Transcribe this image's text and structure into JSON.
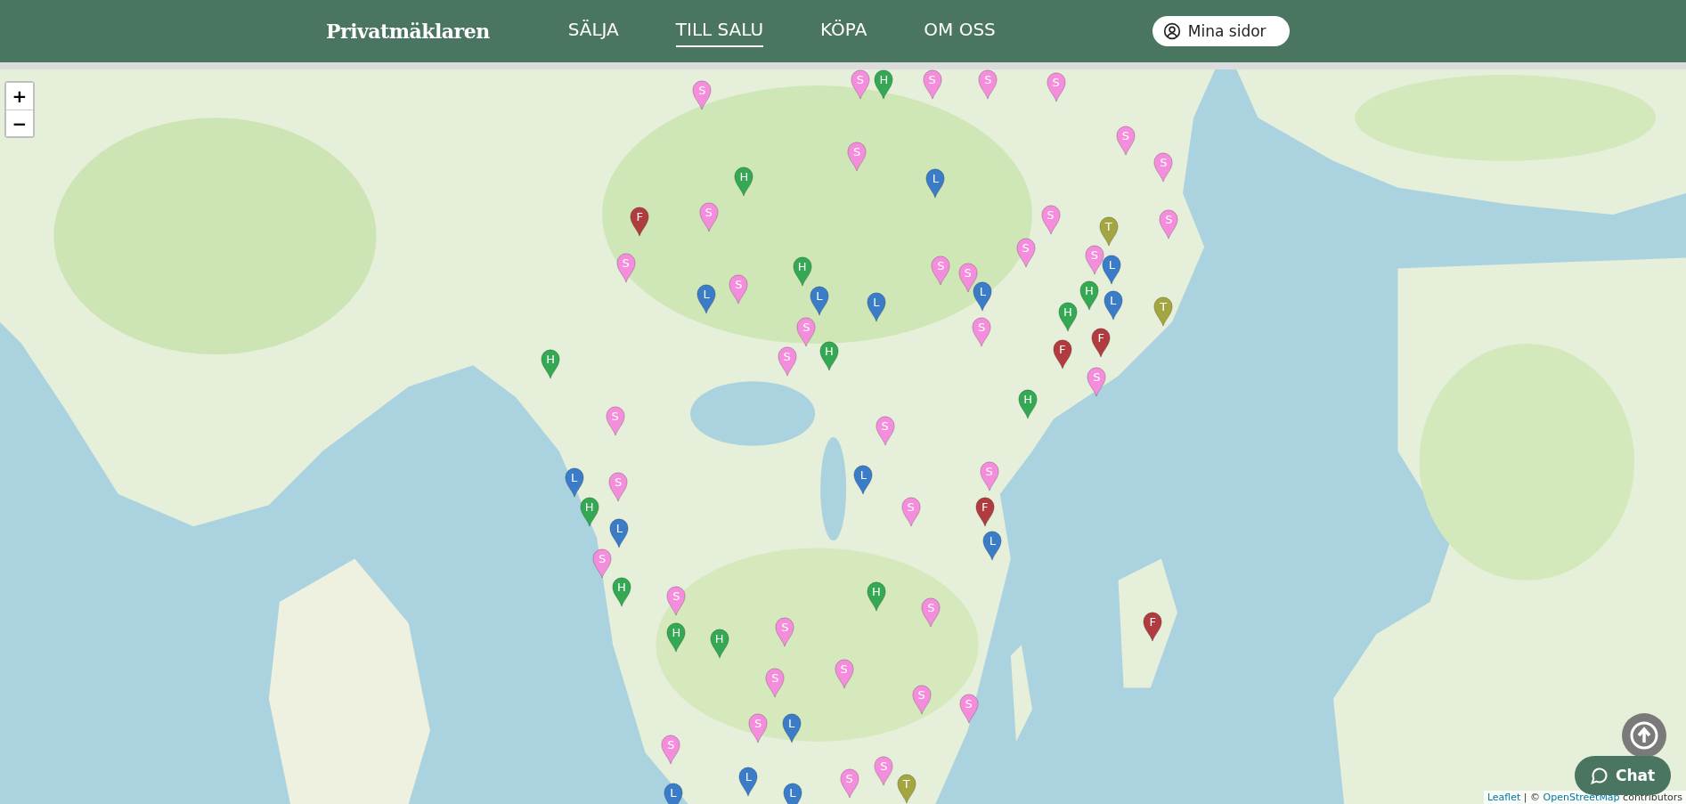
{
  "header": {
    "logo": "Privatmäklaren",
    "nav": [
      {
        "label": "SÄLJA",
        "selected": false
      },
      {
        "label": "TILL SALU",
        "selected": true
      },
      {
        "label": "KÖPA",
        "selected": false
      },
      {
        "label": "OM OSS",
        "selected": false
      }
    ],
    "account_button": "Mina sidor"
  },
  "map": {
    "kind": "picture",
    "zoom_in": "+",
    "zoom_out": "−",
    "attribution": {
      "leaflet": "Leaflet",
      "separator": " | © ",
      "osm": "OpenStreetMap",
      "suffix": " contributors"
    },
    "pins": [
      {
        "letter": "S",
        "color": "#f48ddc"
      },
      {
        "letter": "S",
        "color": "#f48ddc"
      },
      {
        "letter": "H",
        "color": "#34a853"
      },
      {
        "letter": "S",
        "color": "#f48ddc"
      },
      {
        "letter": "S",
        "color": "#f48ddc"
      },
      {
        "letter": "S",
        "color": "#f48ddc"
      },
      {
        "letter": "S",
        "color": "#f48ddc"
      },
      {
        "letter": "S",
        "color": "#f48ddc"
      },
      {
        "letter": "S",
        "color": "#f48ddc"
      },
      {
        "letter": "H",
        "color": "#34a853"
      },
      {
        "letter": "L",
        "color": "#3b7cc9"
      },
      {
        "letter": "F",
        "color": "#b03c40"
      },
      {
        "letter": "S",
        "color": "#f48ddc"
      },
      {
        "letter": "S",
        "color": "#f48ddc"
      },
      {
        "letter": "T",
        "color": "#a3a640"
      },
      {
        "letter": "S",
        "color": "#f48ddc"
      },
      {
        "letter": "S",
        "color": "#f48ddc"
      },
      {
        "letter": "S",
        "color": "#f48ddc"
      },
      {
        "letter": "S",
        "color": "#f48ddc"
      },
      {
        "letter": "H",
        "color": "#34a853"
      },
      {
        "letter": "S",
        "color": "#f48ddc"
      },
      {
        "letter": "S",
        "color": "#f48ddc"
      },
      {
        "letter": "L",
        "color": "#3b7cc9"
      },
      {
        "letter": "L",
        "color": "#3b7cc9"
      },
      {
        "letter": "S",
        "color": "#f48ddc"
      },
      {
        "letter": "L",
        "color": "#3b7cc9"
      },
      {
        "letter": "L",
        "color": "#3b7cc9"
      },
      {
        "letter": "L",
        "color": "#3b7cc9"
      },
      {
        "letter": "H",
        "color": "#34a853"
      },
      {
        "letter": "L",
        "color": "#3b7cc9"
      },
      {
        "letter": "H",
        "color": "#34a853"
      },
      {
        "letter": "T",
        "color": "#a3a640"
      },
      {
        "letter": "S",
        "color": "#f48ddc"
      },
      {
        "letter": "S",
        "color": "#f48ddc"
      },
      {
        "letter": "F",
        "color": "#b03c40"
      },
      {
        "letter": "H",
        "color": "#34a853"
      },
      {
        "letter": "S",
        "color": "#f48ddc"
      },
      {
        "letter": "H",
        "color": "#34a853"
      },
      {
        "letter": "F",
        "color": "#b03c40"
      },
      {
        "letter": "S",
        "color": "#f48ddc"
      },
      {
        "letter": "H",
        "color": "#34a853"
      },
      {
        "letter": "S",
        "color": "#f48ddc"
      },
      {
        "letter": "S",
        "color": "#f48ddc"
      },
      {
        "letter": "L",
        "color": "#3b7cc9"
      },
      {
        "letter": "S",
        "color": "#f48ddc"
      },
      {
        "letter": "L",
        "color": "#3b7cc9"
      },
      {
        "letter": "S",
        "color": "#f48ddc"
      },
      {
        "letter": "H",
        "color": "#34a853"
      },
      {
        "letter": "S",
        "color": "#f48ddc"
      },
      {
        "letter": "F",
        "color": "#b03c40"
      },
      {
        "letter": "L",
        "color": "#3b7cc9"
      },
      {
        "letter": "L",
        "color": "#3b7cc9"
      },
      {
        "letter": "S",
        "color": "#f48ddc"
      },
      {
        "letter": "H",
        "color": "#34a853"
      },
      {
        "letter": "S",
        "color": "#f48ddc"
      },
      {
        "letter": "H",
        "color": "#34a853"
      },
      {
        "letter": "S",
        "color": "#f48ddc"
      },
      {
        "letter": "F",
        "color": "#b03c40"
      },
      {
        "letter": "H",
        "color": "#34a853"
      },
      {
        "letter": "H",
        "color": "#34a853"
      },
      {
        "letter": "S",
        "color": "#f48ddc"
      },
      {
        "letter": "S",
        "color": "#f48ddc"
      },
      {
        "letter": "S",
        "color": "#f48ddc"
      },
      {
        "letter": "S",
        "color": "#f48ddc"
      },
      {
        "letter": "S",
        "color": "#f48ddc"
      },
      {
        "letter": "S",
        "color": "#f48ddc"
      },
      {
        "letter": "L",
        "color": "#3b7cc9"
      },
      {
        "letter": "S",
        "color": "#f48ddc"
      },
      {
        "letter": "L",
        "color": "#3b7cc9"
      },
      {
        "letter": "S",
        "color": "#f48ddc"
      },
      {
        "letter": "S",
        "color": "#f48ddc"
      },
      {
        "letter": "L",
        "color": "#3b7cc9"
      },
      {
        "letter": "L",
        "color": "#3b7cc9"
      },
      {
        "letter": "T",
        "color": "#a3a640"
      }
    ]
  },
  "chat_button": "Chat"
}
